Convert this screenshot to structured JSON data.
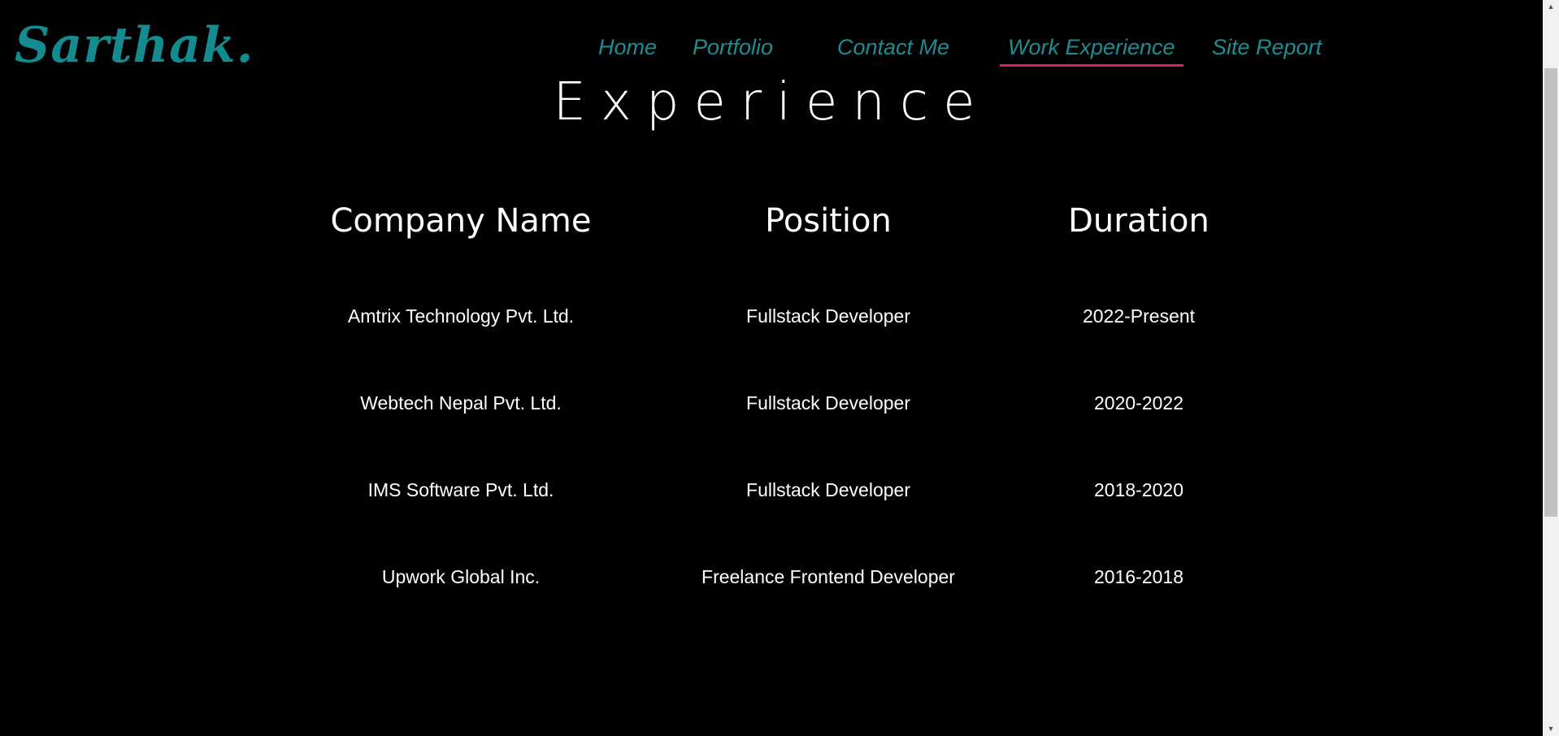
{
  "nav": {
    "logo": "Sarthak.",
    "links": [
      {
        "label": "Home",
        "active": false
      },
      {
        "label": "Portfolio",
        "active": false
      },
      {
        "label": "Contact Me",
        "active": false
      },
      {
        "label": "Work Experience",
        "active": true
      },
      {
        "label": "Site Report",
        "active": false
      }
    ]
  },
  "section": {
    "title": "Experience"
  },
  "table": {
    "headers": [
      "Company Name",
      "Position",
      "Duration"
    ],
    "rows": [
      [
        "Amtrix Technology Pvt. Ltd.",
        "Fullstack Developer",
        "2022-Present"
      ],
      [
        "Webtech Nepal Pvt. Ltd.",
        "Fullstack Developer",
        "2020-2022"
      ],
      [
        "IMS Software Pvt. Ltd.",
        "Fullstack Developer",
        "2018-2020"
      ],
      [
        "Upwork Global Inc.",
        "Freelance Frontend Developer",
        "2016-2018"
      ]
    ]
  },
  "colors": {
    "background": "#000000",
    "accent": "#1c8d93",
    "active_underline": "#e11d5f",
    "text": "#ffffff"
  }
}
